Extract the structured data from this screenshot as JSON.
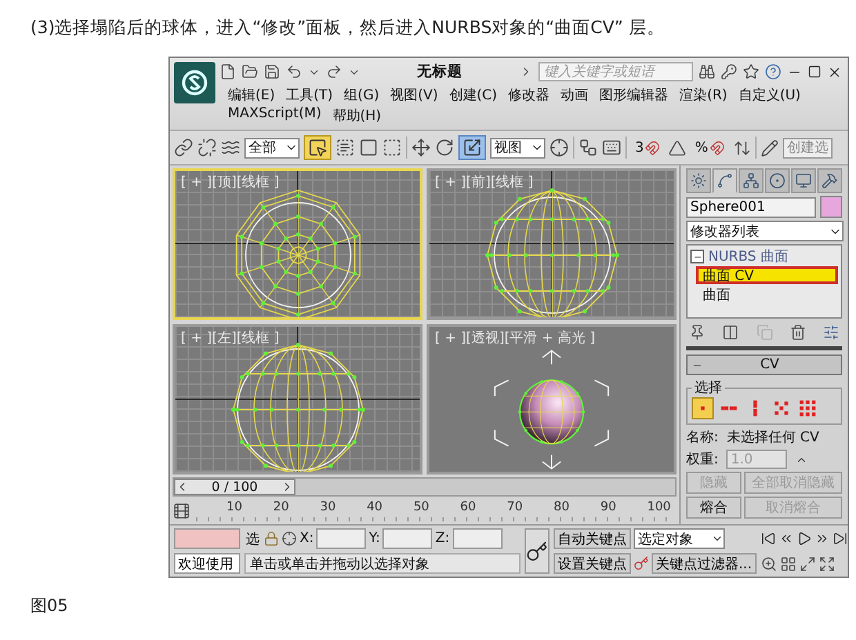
{
  "caption": "(3)选择塌陷后的球体，进入“修改”面板，然后进入NURBS对象的“曲面CV” 层。",
  "window": {
    "title": "无标题",
    "search": {
      "placeholder": "键入关键字或短语"
    },
    "menu": [
      "编辑(E)",
      "工具(T)",
      "组(G)",
      "视图(V)",
      "创建(C)",
      "修改器",
      "动画",
      "图形编辑器",
      "渲染(R)",
      "自定义(U)",
      "MAXScript(M)",
      "帮助(H)"
    ],
    "toolbar": {
      "selection_filter": "全部",
      "select_object_active": true,
      "scale_active": true,
      "reference_coordinate": "视图",
      "snap_toggle": "3",
      "percent_snap": "%",
      "named_selection": {
        "placeholder": "创建选"
      }
    },
    "viewports": [
      {
        "label": "[ + ][顶][线框 ]",
        "kind": "top",
        "active": true
      },
      {
        "label": "[ + ][前][线框 ]",
        "kind": "front",
        "active": false
      },
      {
        "label": "[ + ][左][线框 ]",
        "kind": "left",
        "active": false
      },
      {
        "label": "[ + ][透视][平滑 + 高光 ]",
        "kind": "perspective",
        "active": false
      }
    ],
    "command_panel": {
      "tabs": [
        {
          "selected": false
        },
        {
          "selected": true
        },
        {
          "selected": false
        },
        {
          "selected": false
        },
        {
          "selected": false
        },
        {
          "selected": false
        }
      ],
      "object_name": "Sphere001",
      "modifier_list": "修改器列表",
      "stack": [
        {
          "label": "NURBS 曲面",
          "expanded": true,
          "selected": false,
          "children": [
            {
              "label": "曲面 CV",
              "selected": true
            },
            {
              "label": "曲面",
              "selected": false
            }
          ]
        }
      ],
      "rollout": {
        "title": "CV",
        "expanded": true,
        "group_title": "选择",
        "selection_levels": [
          {
            "selected": true
          },
          {
            "selected": false
          },
          {
            "selected": false
          },
          {
            "selected": false
          },
          {
            "selected": false
          }
        ],
        "name_label": "名称:",
        "name_value": "未选择任何 CV",
        "weight_label": "权重:",
        "weight": {
          "value": "1.0",
          "disabled": true
        },
        "buttons": [
          {
            "label": "隐藏",
            "disabled": true
          },
          {
            "label": "全部取消隐藏",
            "disabled": true
          },
          {
            "label": "熔合",
            "disabled": false
          },
          {
            "label": "取消熔合",
            "disabled": true
          }
        ]
      }
    },
    "timeline": {
      "position": "0 / 100",
      "ticks": [
        "10",
        "20",
        "30",
        "40",
        "50",
        "60",
        "70",
        "80",
        "90",
        "100"
      ]
    },
    "status": {
      "prompt": "欢迎使用",
      "isolate": "选",
      "coords": [
        "X:",
        "Y:",
        "Z:"
      ],
      "message": "单击或单击并拖动以选择对象",
      "auto_key": "自动关键点",
      "key_mode": "选定对象",
      "set_key": "设置关键点",
      "key_filters": "关键点过滤器..."
    }
  },
  "figure_label": "图05"
}
